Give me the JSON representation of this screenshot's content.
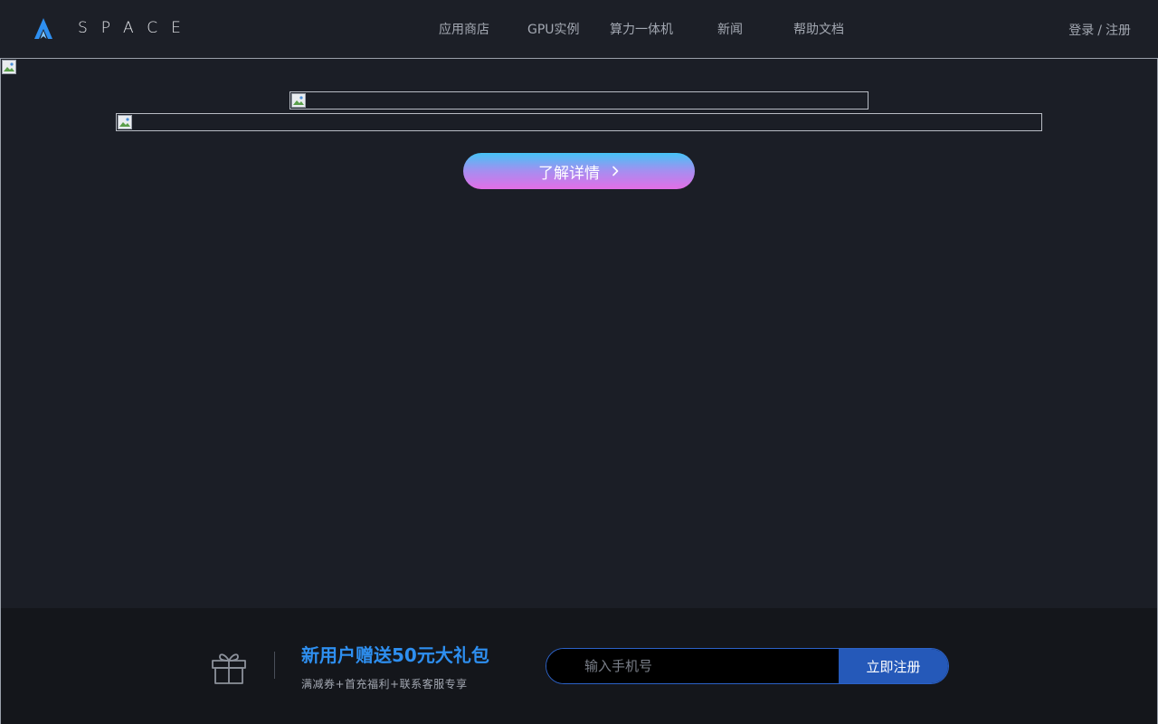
{
  "brand": {
    "name": "SPACE",
    "icon": "rocket-logo-icon",
    "accent": "#2e8ff0"
  },
  "nav": {
    "items": [
      {
        "label": "应用商店"
      },
      {
        "label": "GPU实例"
      },
      {
        "label": "算力一体机"
      },
      {
        "label": "新闻"
      },
      {
        "label": "帮助文档"
      }
    ]
  },
  "auth": {
    "login": "登录",
    "separator": "/",
    "register": "注册"
  },
  "hero": {
    "cta_label": "了解详情",
    "cta_icon": "chevron-right-icon",
    "cta_gradient": [
      "#45c3f6",
      "#e36ee6"
    ]
  },
  "promo": {
    "icon": "gift-icon",
    "title": "新用户赠送50元大礼包",
    "subtitle": "满减券+首充福利+联系客服专享",
    "phone_placeholder": "输入手机号",
    "phone_value": "",
    "submit_label": "立即注册",
    "button_color": "#2559b9"
  }
}
